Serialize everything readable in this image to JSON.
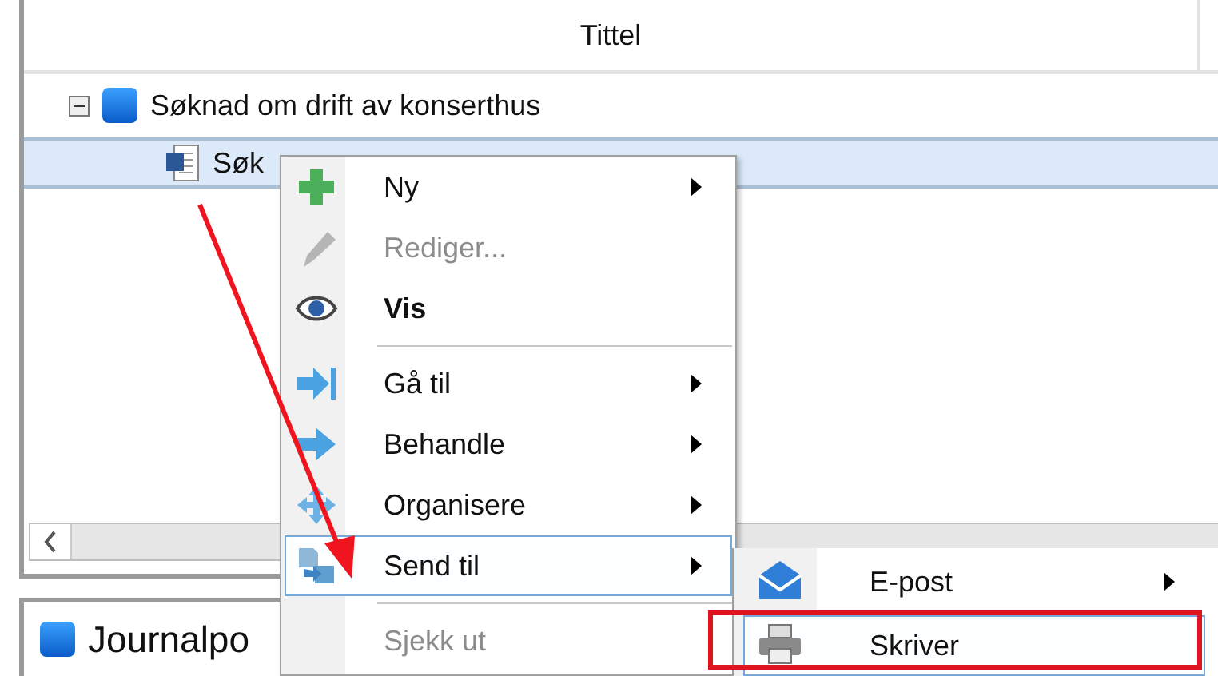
{
  "tree": {
    "columns": [
      "Tittel"
    ],
    "rows": [
      {
        "title": "Søknad om drift av konserthus",
        "kind": "case",
        "expanded": true,
        "selected": false
      },
      {
        "title": "Søk",
        "kind": "document",
        "selected": true
      }
    ]
  },
  "lower_panel": {
    "title": "Journalpo"
  },
  "context_menu": [
    {
      "kind": "item",
      "label": "Ny",
      "disabled": false,
      "bold": false,
      "submenu": true,
      "selected": false
    },
    {
      "kind": "item",
      "label": "Rediger...",
      "disabled": true,
      "bold": false,
      "submenu": false,
      "selected": false
    },
    {
      "kind": "item",
      "label": "Vis",
      "disabled": false,
      "bold": true,
      "submenu": false,
      "selected": false
    },
    {
      "kind": "separator"
    },
    {
      "kind": "item",
      "label": "Gå til",
      "disabled": false,
      "bold": false,
      "submenu": true,
      "selected": false
    },
    {
      "kind": "item",
      "label": "Behandle",
      "disabled": false,
      "bold": false,
      "submenu": true,
      "selected": false
    },
    {
      "kind": "item",
      "label": "Organisere",
      "disabled": false,
      "bold": false,
      "submenu": true,
      "selected": false
    },
    {
      "kind": "item",
      "label": "Send til",
      "disabled": false,
      "bold": false,
      "submenu": true,
      "selected": true
    },
    {
      "kind": "separator"
    },
    {
      "kind": "item",
      "label": "Sjekk ut",
      "disabled": true,
      "bold": false,
      "submenu": false,
      "selected": false
    }
  ],
  "submenu": [
    {
      "label": "E-post",
      "submenu": true,
      "selected": false,
      "highlighted": false
    },
    {
      "label": "Skriver",
      "submenu": false,
      "selected": true,
      "highlighted": true
    }
  ]
}
